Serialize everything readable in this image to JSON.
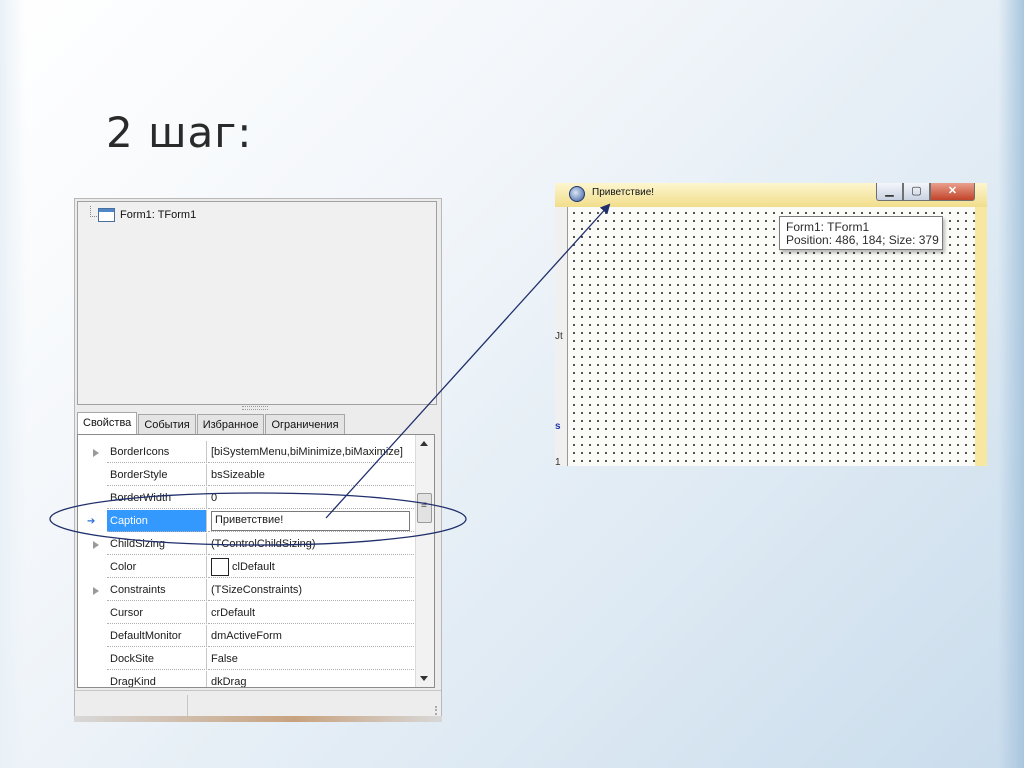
{
  "slide": {
    "title": "2 шаг:"
  },
  "inspector": {
    "tree_node": "Form1: TForm1",
    "tabs": [
      "Свойства",
      "События",
      "Избранное",
      "Ограничения"
    ],
    "properties": [
      {
        "name": "BorderIcons",
        "value": "[biSystemMenu,biMinimize,biMaximize]",
        "expandable": true
      },
      {
        "name": "BorderStyle",
        "value": "bsSizeable"
      },
      {
        "name": "BorderWidth",
        "value": "0"
      },
      {
        "name": "Caption",
        "value": "Приветствие!",
        "selected": true
      },
      {
        "name": "ChildSizing",
        "value": "(TControlChildSizing)",
        "expandable": true
      },
      {
        "name": "Color",
        "value": "clDefault"
      },
      {
        "name": "Constraints",
        "value": "(TSizeConstraints)",
        "expandable": true
      },
      {
        "name": "Cursor",
        "value": "crDefault"
      },
      {
        "name": "DefaultMonitor",
        "value": "dmActiveForm"
      },
      {
        "name": "DockSite",
        "value": "False"
      },
      {
        "name": "DragKind",
        "value": "dkDrag"
      }
    ]
  },
  "designer": {
    "window_title": "Приветствие!",
    "hint_line1": "Form1: TForm1",
    "hint_line2": "Position: 486, 184; Size: 379",
    "left_strip_chars": [
      "Jt",
      "s",
      "1"
    ]
  },
  "colors": {
    "selection": "#3399ff",
    "annotation": "#1f2f6b",
    "title_bar": "#f6e9a6"
  },
  "icons": [
    "form-icon",
    "app-icon",
    "minimize-icon",
    "maximize-icon",
    "close-icon",
    "selected-row-arrow-icon",
    "expand-arrow-icon"
  ]
}
